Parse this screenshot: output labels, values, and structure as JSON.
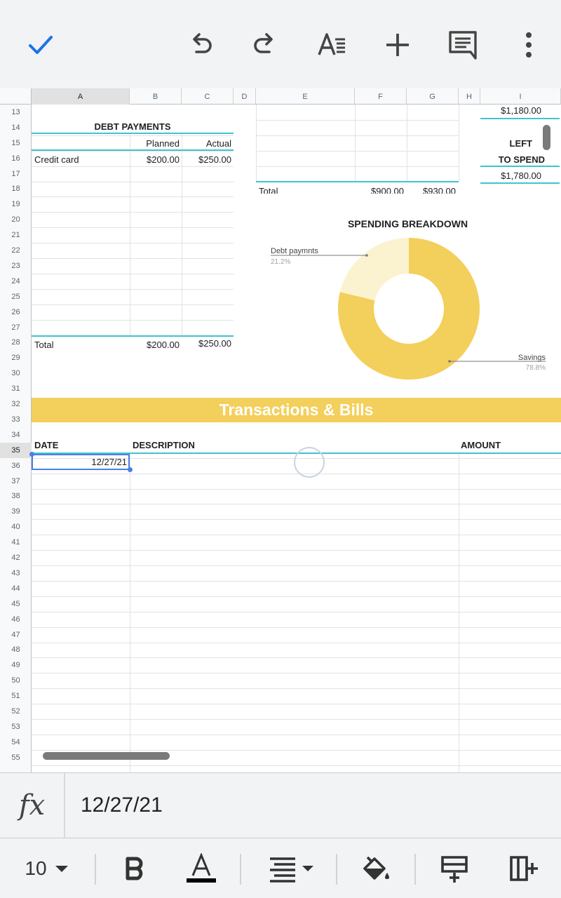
{
  "toolbar": {
    "icons": [
      "check-icon",
      "undo-icon",
      "redo-icon",
      "text-format-icon",
      "plus-icon",
      "comment-icon",
      "more-vert-icon"
    ]
  },
  "columns": [
    "A",
    "B",
    "C",
    "D",
    "E",
    "F",
    "G",
    "H",
    "I"
  ],
  "rows": [
    "13",
    "14",
    "15",
    "16",
    "17",
    "18",
    "19",
    "20",
    "21",
    "22",
    "23",
    "24",
    "25",
    "26",
    "27",
    "28",
    "29",
    "30",
    "31",
    "32",
    "33",
    "34",
    "35",
    "36",
    "37",
    "38",
    "39",
    "40",
    "41",
    "42",
    "43",
    "44",
    "45",
    "46",
    "47",
    "48",
    "49",
    "50",
    "51",
    "52",
    "53",
    "54",
    "55"
  ],
  "selected": {
    "column": "A",
    "row": "35"
  },
  "debt_payments": {
    "title": "DEBT PAYMENTS",
    "planned_header": "Planned",
    "actual_header": "Actual",
    "item_label": "Credit card",
    "item_planned": "$200.00",
    "item_actual": "$250.00",
    "total_label": "Total",
    "total_planned": "$200.00",
    "total_actual": "$250.00"
  },
  "right_table": {
    "total_label": "Total",
    "total_planned": "$900.00",
    "total_actual": "$930.00"
  },
  "summary": {
    "top_value": "$1,180.00",
    "left_label_1": "LEFT",
    "left_label_2": "TO SPEND",
    "left_value": "$1,780.00"
  },
  "chart_data": {
    "type": "pie",
    "title": "SPENDING BREAKDOWN",
    "slices": [
      {
        "label": "Debt paymnts",
        "percent_label": "21.2%",
        "value": 21.2,
        "color": "#fbf3d0"
      },
      {
        "label": "Savings",
        "percent_label": "78.8%",
        "value": 78.8,
        "color": "#f3cf5b"
      }
    ],
    "donut": true
  },
  "transactions": {
    "title": "Transactions & Bills",
    "date_header": "DATE",
    "description_header": "DESCRIPTION",
    "amount_header": "AMOUNT",
    "first_date": "12/27/21"
  },
  "formula_bar": {
    "fx_label": "fx",
    "value": "12/27/21"
  },
  "bottom_toolbar": {
    "font_size": "10",
    "icons": [
      "font-size-dropdown-icon",
      "bold-icon",
      "text-color-icon",
      "align-icon",
      "fill-color-icon",
      "insert-row-icon",
      "insert-column-icon"
    ]
  },
  "colors": {
    "accent": "#3fc4cf",
    "band": "#f3cf5b",
    "selection": "#4a80e8"
  }
}
